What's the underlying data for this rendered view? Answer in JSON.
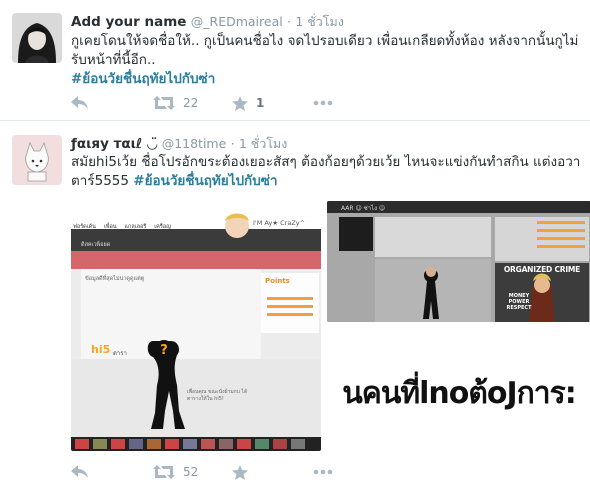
{
  "tweets": [
    {
      "fullname": "Add your name",
      "handle": "@_REDmaireal",
      "separator": "·",
      "time": "1 ชั่วโมง",
      "text": "กูเคยโดนให้จดชื่อให้.. กูเป็นคนชื่อไง จดไปรอบเดียว เพื่อนเกลียดทั้งห้อง หลังจากนั้นกูไม่รับหน้าที่นี้อีก..",
      "hashtag": "#ย้อนวัยชื่นฤทัยไปกับซ่า",
      "retweets": "22",
      "favorites": "1"
    },
    {
      "fullname": "ƒαιяу тαιℓ ◡̈",
      "handle": "@118time",
      "separator": "·",
      "time": "1 ชั่วโมง",
      "text": "สมัยhi5เว้ย ชื่อโปรอักขระต้องเยอะสัสๆ ต้องก้อยๆด้วยเว้ย ไหนจะแข่งกันทำสกิน แต่งอวาตาร์5555",
      "hashtag": "#ย้อนวัยชื่นฤทัยไปกับซ่า",
      "retweets": "52",
      "favorites": "",
      "media": {
        "hi5_profile": {
          "nav": [
            "ฟอร์ดเด้น",
            "เพื่อน",
            "แกลเลอรี",
            "เครือญ"
          ],
          "subnav": "ดิสคเวพ็อยด",
          "username": "I'M Ay★ CraZy^",
          "panel_title": "Points",
          "logo": "hi5",
          "logo_sub": "ดารา",
          "caption": "เพื่อนคุณ ขณะนั่งผ้ามกบ ได้ตารางให้ใน hi5!",
          "list_header": "ข้อมูลดีที่สุดไม่น่าดูดูแต่ตู"
        },
        "game_screenshot": {
          "username": "AAR ☺ ซ่าไง ☺",
          "logo": "ORGANIZED CRIME",
          "subtitle": "MONEY POWER RESPECT"
        },
        "text_banner": "นคนที่lnoต้oJการ:"
      }
    }
  ],
  "colors": {
    "name": "#292f33",
    "meta": "#8899a6",
    "hashtag": "#2a7f9e",
    "action_icon": "#aab8c2",
    "separator": "#e1e8ed"
  }
}
